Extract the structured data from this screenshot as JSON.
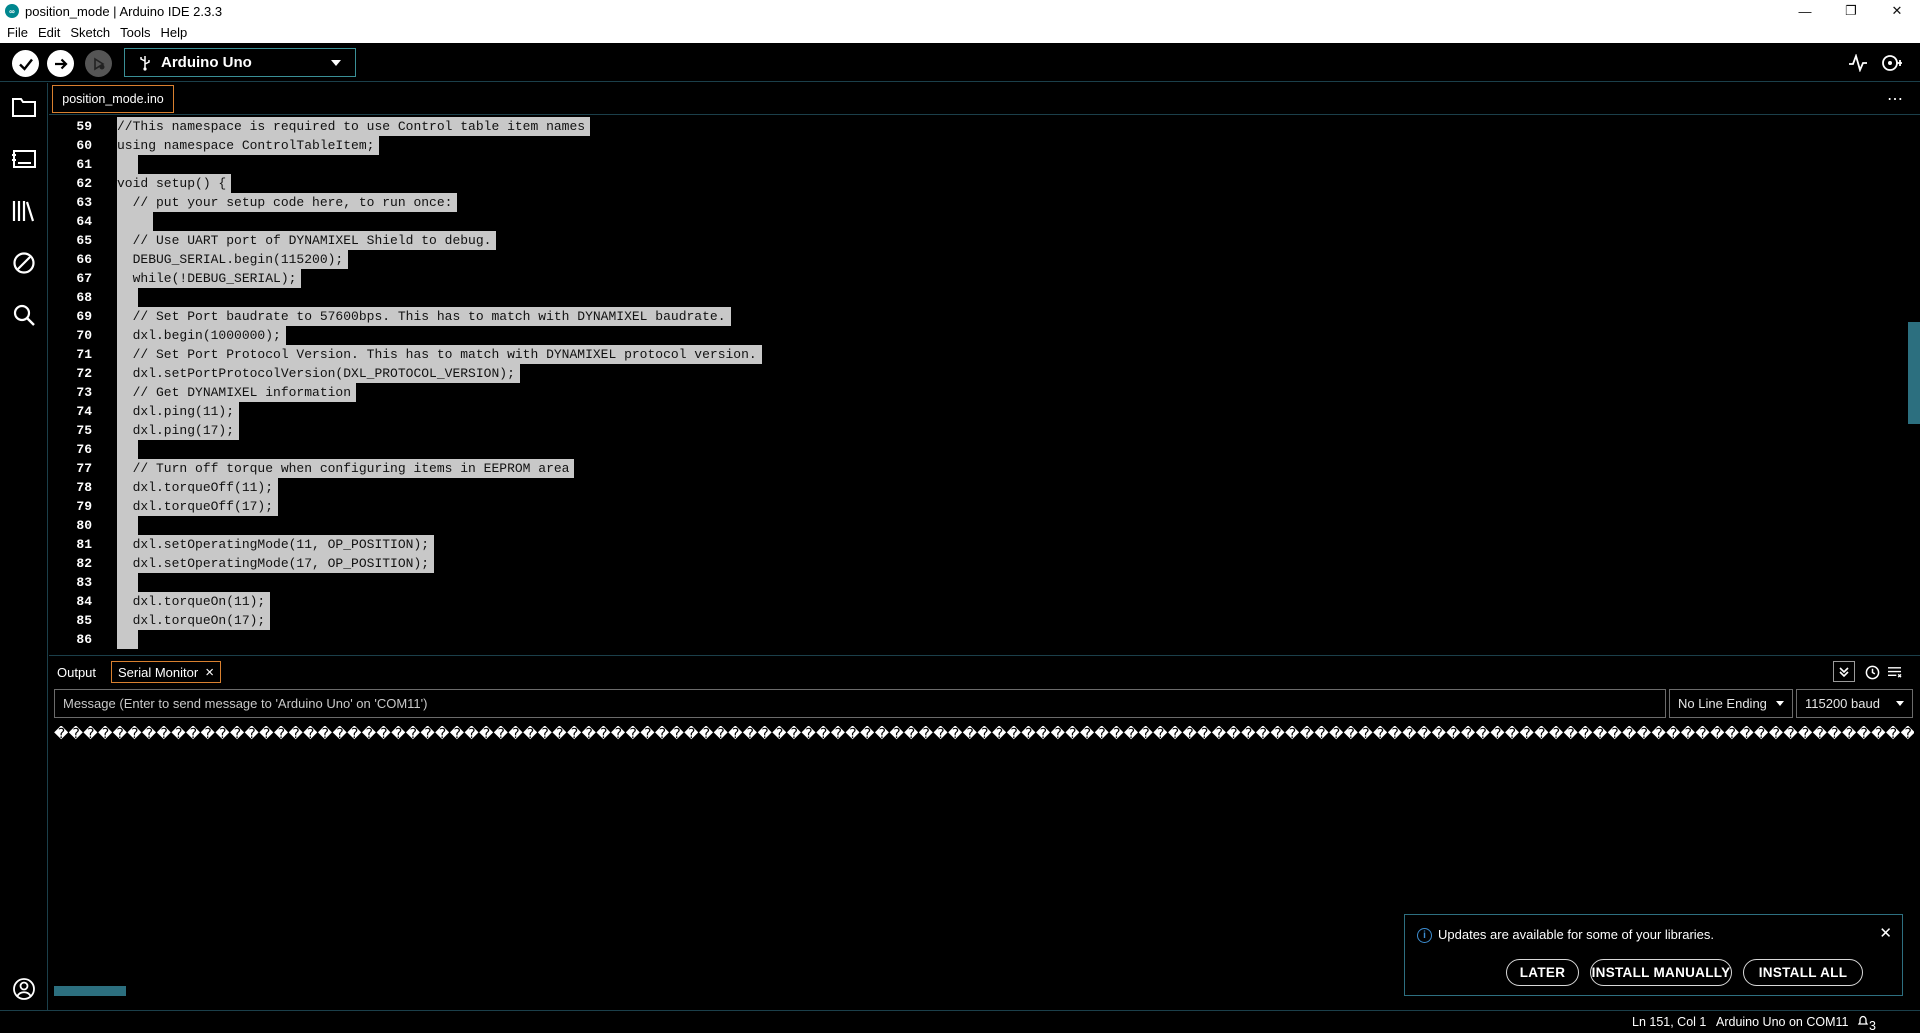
{
  "window": {
    "title": "position_mode | Arduino IDE 2.3.3",
    "minimize": "—",
    "maximize": "❐",
    "close": "✕"
  },
  "menu": [
    "File",
    "Edit",
    "Sketch",
    "Tools",
    "Help"
  ],
  "toolbar": {
    "board": "Arduino Uno"
  },
  "editor": {
    "file_tab": "position_mode.ino",
    "lines": [
      {
        "no": "59",
        "text": "//This namespace is required to use Control table item names"
      },
      {
        "no": "60",
        "text": "using namespace ControlTableItem;"
      },
      {
        "no": "61",
        "text": "  "
      },
      {
        "no": "62",
        "text": "void setup() {"
      },
      {
        "no": "63",
        "text": "  // put your setup code here, to run once:"
      },
      {
        "no": "64",
        "text": "    "
      },
      {
        "no": "65",
        "text": "  // Use UART port of DYNAMIXEL Shield to debug."
      },
      {
        "no": "66",
        "text": "  DEBUG_SERIAL.begin(115200);"
      },
      {
        "no": "67",
        "text": "  while(!DEBUG_SERIAL);"
      },
      {
        "no": "68",
        "text": "  "
      },
      {
        "no": "69",
        "text": "  // Set Port baudrate to 57600bps. This has to match with DYNAMIXEL baudrate."
      },
      {
        "no": "70",
        "text": "  dxl.begin(1000000);"
      },
      {
        "no": "71",
        "text": "  // Set Port Protocol Version. This has to match with DYNAMIXEL protocol version."
      },
      {
        "no": "72",
        "text": "  dxl.setPortProtocolVersion(DXL_PROTOCOL_VERSION);"
      },
      {
        "no": "73",
        "text": "  // Get DYNAMIXEL information"
      },
      {
        "no": "74",
        "text": "  dxl.ping(11);"
      },
      {
        "no": "75",
        "text": "  dxl.ping(17);"
      },
      {
        "no": "76",
        "text": "  "
      },
      {
        "no": "77",
        "text": "  // Turn off torque when configuring items in EEPROM area"
      },
      {
        "no": "78",
        "text": "  dxl.torqueOff(11);"
      },
      {
        "no": "79",
        "text": "  dxl.torqueOff(17);"
      },
      {
        "no": "80",
        "text": "  "
      },
      {
        "no": "81",
        "text": "  dxl.setOperatingMode(11, OP_POSITION);"
      },
      {
        "no": "82",
        "text": "  dxl.setOperatingMode(17, OP_POSITION);"
      },
      {
        "no": "83",
        "text": "  "
      },
      {
        "no": "84",
        "text": "  dxl.torqueOn(11);"
      },
      {
        "no": "85",
        "text": "  dxl.torqueOn(17);"
      },
      {
        "no": "86",
        "text": "  "
      }
    ]
  },
  "panel": {
    "tabs": [
      "Output",
      "Serial Monitor"
    ],
    "tab_close": "×",
    "message_placeholder": "Message (Enter to send message to 'Arduino Uno' on 'COM11')",
    "line_ending": "No Line Ending",
    "baud": "115200 baud",
    "serial_output": "��������������������������������������������������������������������������������������������������������������������������������������������������������������������������������������������������������"
  },
  "notification": {
    "message": "Updates are available for some of your libraries.",
    "later": "LATER",
    "install_manually": "INSTALL MANUALLY",
    "install_all": "INSTALL ALL"
  },
  "status": {
    "position": "Ln 151, Col 1",
    "board_port": "Arduino Uno on COM11",
    "notifications": "3"
  }
}
